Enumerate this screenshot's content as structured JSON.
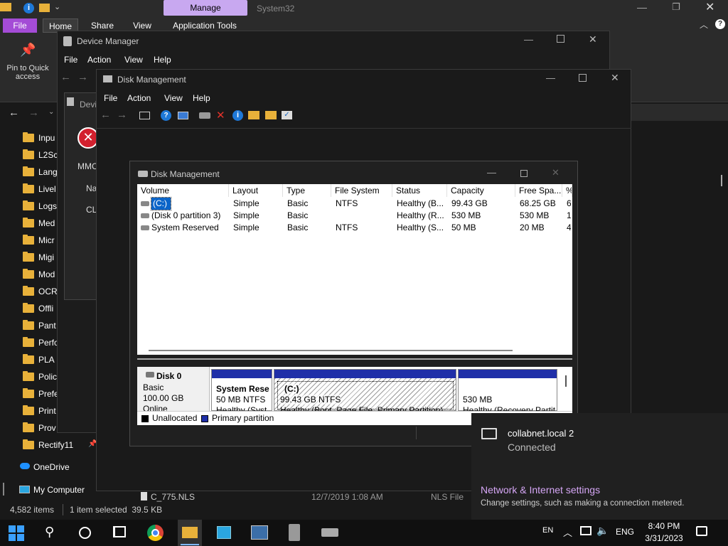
{
  "explorer": {
    "ribbon_tab_manage": "Manage",
    "window_title": "System32",
    "tabs": [
      "File",
      "Home",
      "Share",
      "View",
      "Application Tools"
    ],
    "pin_label": "Pin to Quick access",
    "nav_items": [
      "Inpu",
      "L2Sc",
      "Lang",
      "Livel",
      "Logs",
      "Med",
      "Micr",
      "Migi",
      "Mod",
      "OCR",
      "Offli",
      "Pant",
      "Perfo",
      "PLA",
      "Polic",
      "Prefe",
      "Print",
      "Prov",
      "Rectify11"
    ],
    "onedrive": "OneDrive",
    "my_computer": "My Computer",
    "file_row": {
      "name": "C_775.NLS",
      "date": "12/7/2019 1:08 AM",
      "type": "NLS File"
    },
    "status_items": "4,582 items",
    "status_selected": "1 item selected  39.5 KB"
  },
  "device_manager": {
    "title": "Device Manager",
    "menu": [
      "File",
      "Action",
      "View",
      "Help"
    ],
    "dialog_title": "Devi",
    "dialog_lines": [
      "MMC",
      "Na",
      "CLS"
    ]
  },
  "disk_mgmt_outer": {
    "title": "Disk Management",
    "menu": [
      "File",
      "Action",
      "View",
      "Help"
    ]
  },
  "disk_mgmt": {
    "title": "Disk Management",
    "columns": [
      "Volume",
      "Layout",
      "Type",
      "File System",
      "Status",
      "Capacity",
      "Free Spa...",
      "%"
    ],
    "rows": [
      {
        "volume": "(C:)",
        "layout": "Simple",
        "type": "Basic",
        "fs": "NTFS",
        "status": "Healthy (B...",
        "capacity": "99.43 GB",
        "free": "68.25 GB",
        "pct": "6"
      },
      {
        "volume": "(Disk 0 partition 3)",
        "layout": "Simple",
        "type": "Basic",
        "fs": "",
        "status": "Healthy (R...",
        "capacity": "530 MB",
        "free": "530 MB",
        "pct": "1"
      },
      {
        "volume": "System Reserved",
        "layout": "Simple",
        "type": "Basic",
        "fs": "NTFS",
        "status": "Healthy (S...",
        "capacity": "50 MB",
        "free": "20 MB",
        "pct": "4"
      }
    ],
    "disk": {
      "name": "Disk 0",
      "kind": "Basic",
      "size": "100.00 GB",
      "state": "Online"
    },
    "partitions": [
      {
        "name": "System Rese",
        "size": "50 MB NTFS",
        "status": "Healthy (Syst"
      },
      {
        "name": "(C:)",
        "size": "99.43 GB NTFS",
        "status": "Healthy (Boot, Page File, Primary Partition)"
      },
      {
        "name": "",
        "size": "530 MB",
        "status": "Healthy (Recovery Partit"
      }
    ],
    "legend": [
      "Unallocated",
      "Primary partition"
    ]
  },
  "network_flyout": {
    "network_name": "collabnet.local 2",
    "network_status": "Connected",
    "settings_link": "Network & Internet settings",
    "settings_desc": "Change settings, such as making a connection metered."
  },
  "taskbar": {
    "lang_short": "EN",
    "lang": "ENG",
    "time": "8:40 PM",
    "date": "3/31/2023"
  },
  "colors": {
    "accent_manage": "#c8a8f0",
    "file_tab": "#a44cd6",
    "partition_bar": "#1f2fa8",
    "link": "#d5a6f5"
  }
}
